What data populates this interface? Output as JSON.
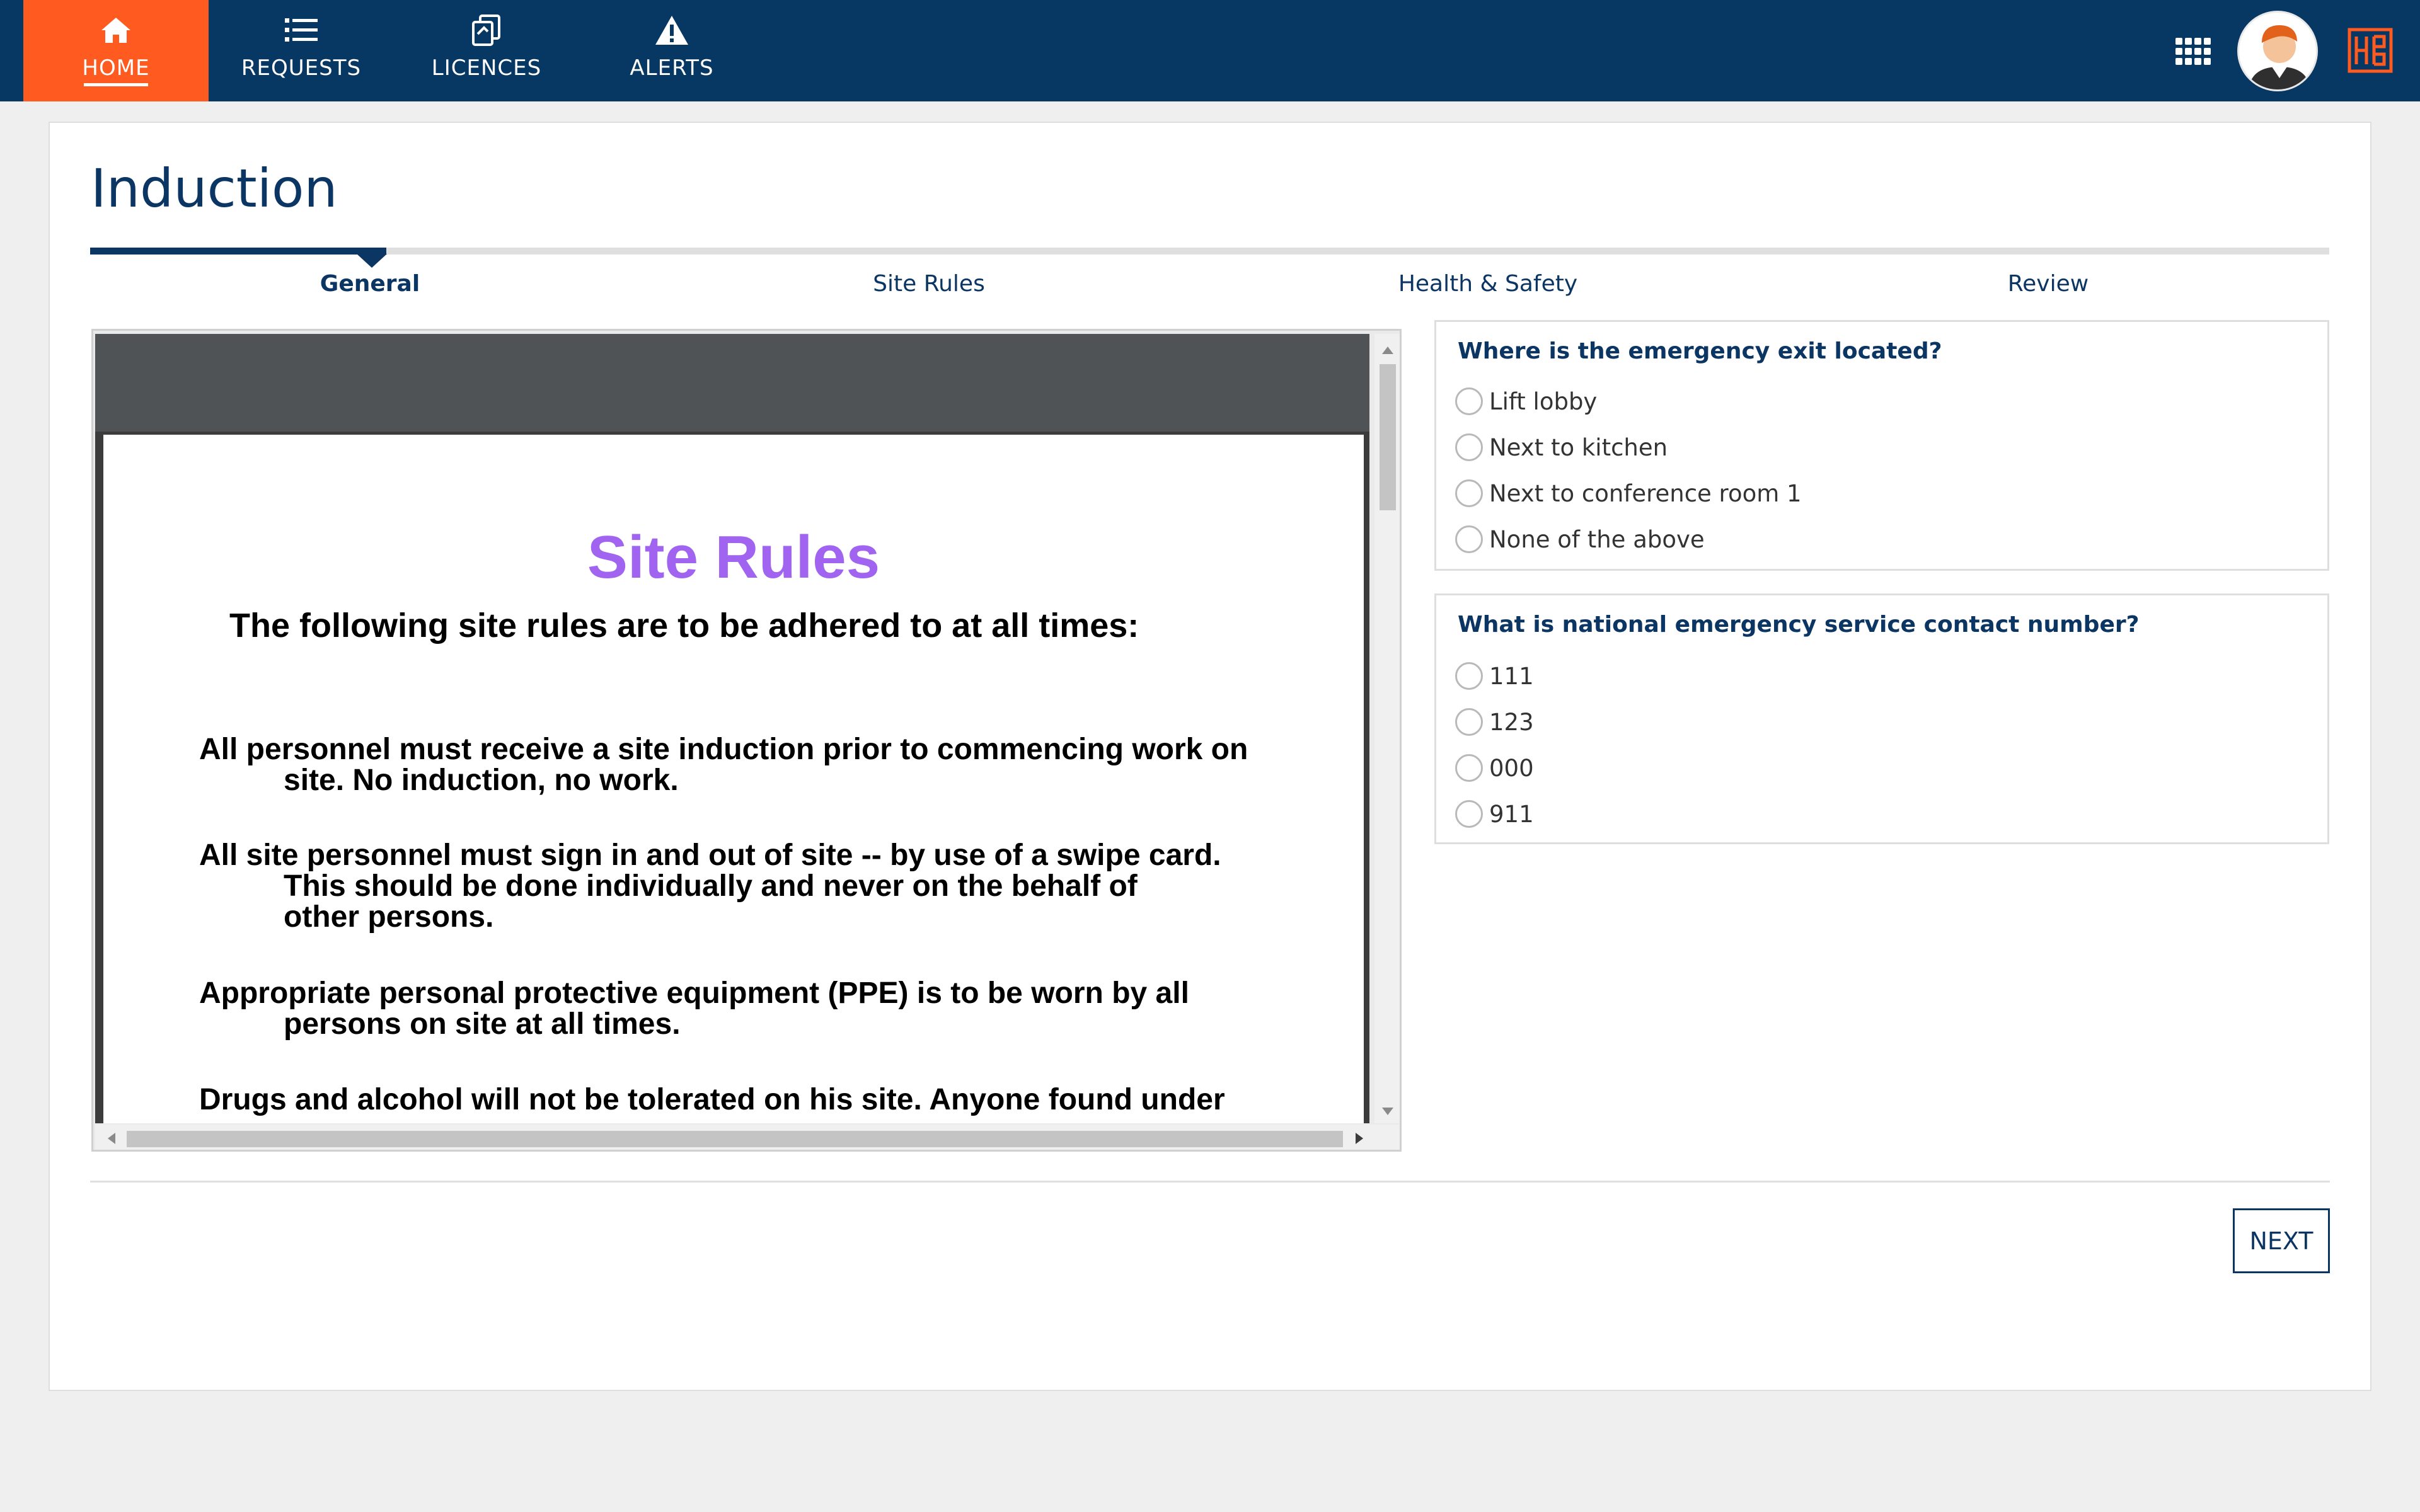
{
  "nav": {
    "items": [
      {
        "label": "HOME",
        "icon": "home-icon",
        "active": true
      },
      {
        "label": "REQUESTS",
        "icon": "list-icon",
        "active": false
      },
      {
        "label": "LICENCES",
        "icon": "licences-icon",
        "active": false
      },
      {
        "label": "ALERTS",
        "icon": "alert-triangle-icon",
        "active": false
      }
    ],
    "apps_icon": "apps-grid-icon",
    "avatar_icon": "user-avatar-icon",
    "brand_icon": "brand-logo-icon"
  },
  "colors": {
    "nav_background": "#073763",
    "active_tab": "#ff5a1f",
    "primary": "#0b3563",
    "doc_title": "#a064f0"
  },
  "page": {
    "title": "Induction"
  },
  "stepper": {
    "steps": [
      "General",
      "Site Rules",
      "Health & Safety",
      "Review"
    ],
    "current": "General"
  },
  "document": {
    "title": "Site Rules",
    "subtitle": "The following site rules are to be adhered to at all times:",
    "rules": [
      {
        "first": "All personnel must receive a site induction prior to commencing work on",
        "rest": "site. No induction, no work."
      },
      {
        "first": "All site personnel must sign in and out of site -- by use of a swipe card.",
        "rest": "This should be done individually and never on the behalf of other persons."
      },
      {
        "first": "Appropriate personal protective equipment (PPE) is to be worn by all",
        "rest": "persons on site at all times."
      },
      {
        "first": "Drugs and alcohol will not be tolerated on his site. Anyone found under",
        "rest": ""
      }
    ]
  },
  "questions": [
    {
      "text": "Where is the emergency exit located?",
      "options": [
        "Lift lobby",
        "Next to kitchen",
        "Next to conference room 1",
        "None of the above"
      ]
    },
    {
      "text": "What is national emergency service contact number?",
      "options": [
        "111",
        "123",
        "000",
        "911"
      ]
    }
  ],
  "footer": {
    "next_label": "NEXT"
  }
}
